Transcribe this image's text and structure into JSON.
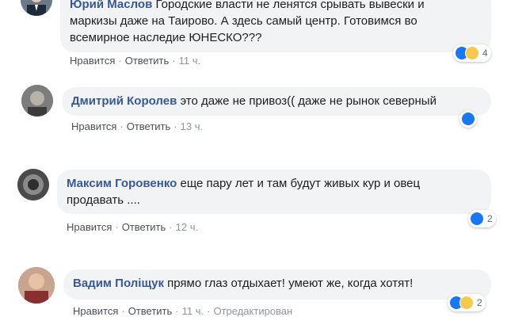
{
  "comments": [
    {
      "author": "Юрий Маслов",
      "text_lines": [
        "Городские власти не ленятся срывать вывески и",
        "маркизы даже на Таирово. А здесь самый центр. Готовимся во",
        "всемирное наследие ЮНЕСКО???"
      ],
      "like_label": "Нравится",
      "reply_label": "Ответить",
      "time": "11 ч.",
      "reaction_count": "4",
      "reaction_icons": [
        "like-icon",
        "haha-icon"
      ]
    },
    {
      "author": "Дмитрий Королев",
      "text_lines": [
        "это даже не привоз(( даже не рынок северный"
      ],
      "like_label": "Нравится",
      "reply_label": "Ответить",
      "time": "13 ч.",
      "reaction_count": "",
      "reaction_icons": [
        "like-icon"
      ]
    },
    {
      "author": "Максим Горовенко",
      "text_lines": [
        "еще пару лет и там будут живых кур и овец",
        "продавать ...."
      ],
      "like_label": "Нравится",
      "reply_label": "Ответить",
      "time": "12 ч.",
      "reaction_count": "2",
      "reaction_icons": [
        "like-icon"
      ]
    },
    {
      "author": "Вадим Поліщук",
      "text_lines": [
        "прямо глаз отдыхает! умеют же, когда хотят!"
      ],
      "like_label": "Нравится",
      "reply_label": "Ответить",
      "time": "11 ч.",
      "edited_label": "Отредактирован",
      "reaction_count": "2",
      "reaction_icons": [
        "like-icon",
        "haha-icon"
      ]
    }
  ],
  "colors": {
    "author": "#385898",
    "bubble": "#f2f3f5",
    "like": "#1877f2",
    "haha": "#f7c94b"
  }
}
